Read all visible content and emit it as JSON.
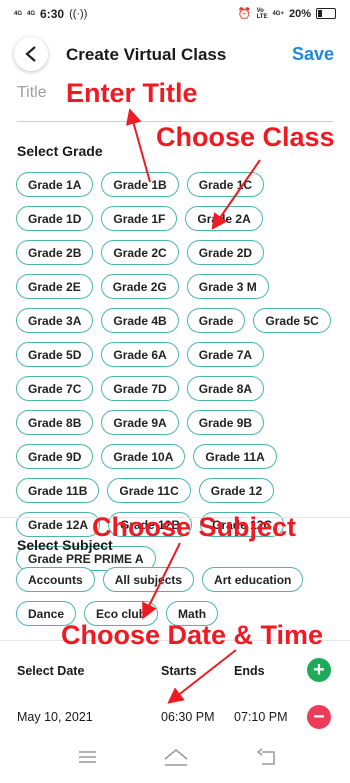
{
  "status": {
    "sim1": "4G",
    "sim2": "4G",
    "time": "6:30",
    "right_net": "4G+",
    "battery": "20%"
  },
  "header": {
    "title": "Create Virtual Class",
    "save": "Save"
  },
  "title_field": {
    "placeholder": "Title"
  },
  "grade_section": {
    "label": "Select Grade",
    "grades": [
      "Grade 1A",
      "Grade 1B",
      "Grade 1C",
      "Grade 1D",
      "Grade 1F",
      "Grade 2A",
      "Grade 2B",
      "Grade 2C",
      "Grade 2D",
      "Grade 2E",
      "Grade 2G",
      "Grade 3 M",
      "Grade 3A",
      "Grade 4B",
      "Grade",
      "Grade 5C",
      "Grade 5D",
      "Grade 6A",
      "Grade 7A",
      "Grade 7C",
      "Grade 7D",
      "Grade 8A",
      "Grade 8B",
      "Grade 9A",
      "Grade 9B",
      "Grade 9D",
      "Grade 10A",
      "Grade 11A",
      "Grade 11B",
      "Grade 11C",
      "Grade 12",
      "Grade 12A",
      "Grade 12B",
      "Grade 12C",
      "Grade PRE PRIME A"
    ]
  },
  "subject_section": {
    "label": "Select Subject",
    "subjects": [
      "Accounts",
      "All subjects",
      "Art education",
      "Dance",
      "Eco club",
      "Math"
    ]
  },
  "date_section": {
    "date_label": "Select Date",
    "starts_label": "Starts",
    "ends_label": "Ends",
    "date_value": "May 10, 2021",
    "start_value": "06:30 PM",
    "end_value": "07:10 PM"
  },
  "annotations": {
    "enter_title": "Enter Title",
    "choose_class": "Choose Class",
    "choose_subject": "Choose Subject",
    "choose_date_time": "Choose Date & Time"
  },
  "colors": {
    "accent": "#1e88e5",
    "chip_border": "#4db6ac",
    "add": "#1faa59",
    "remove": "#ef3b5a",
    "annotation": "#ee1b24"
  }
}
